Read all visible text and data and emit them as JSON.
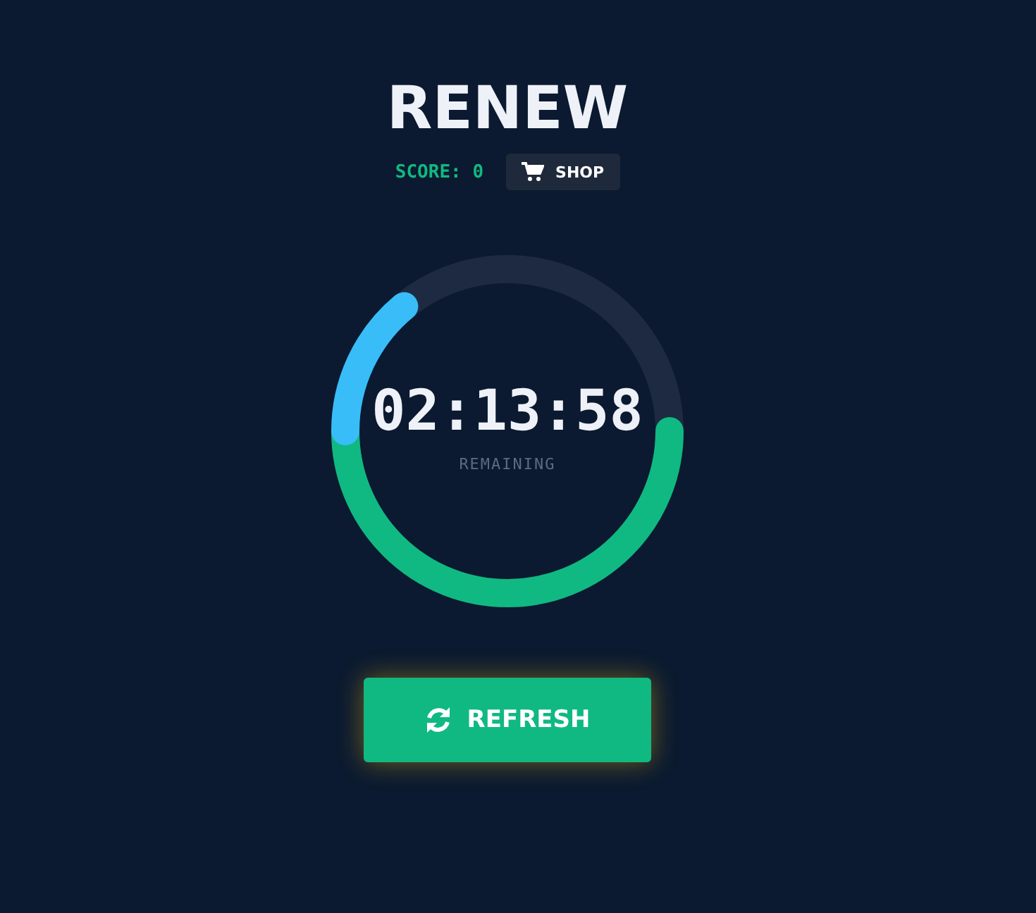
{
  "title": "RENEW",
  "score": "SCORE: 0",
  "shop_button": "SHOP",
  "timer": {
    "time": "02:13:58",
    "caption": "REMAINING",
    "segments": [
      {
        "color": "#10b981"
      },
      {
        "color": "#38bdf8"
      }
    ]
  },
  "refresh_button": "REFRESH"
}
